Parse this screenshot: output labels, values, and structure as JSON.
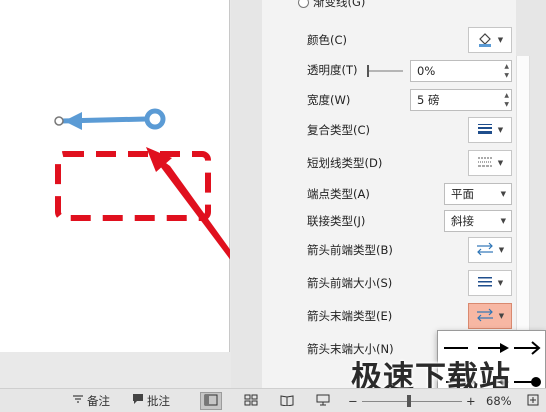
{
  "pane": {
    "gradient_line_label": "渐变线(G)",
    "color_label": "颜色(C)",
    "transparency_label": "透明度(T)",
    "transparency_value": "0%",
    "width_label": "宽度(W)",
    "width_value": "5 磅",
    "compound_type_label": "复合类型(C)",
    "dash_type_label": "短划线类型(D)",
    "cap_type_label": "端点类型(A)",
    "cap_type_value": "平面",
    "join_type_label": "联接类型(J)",
    "join_type_value": "斜接",
    "begin_arrow_type_label": "箭头前端类型(B)",
    "begin_arrow_size_label": "箭头前端大小(S)",
    "end_arrow_type_label": "箭头末端类型(E)",
    "end_arrow_size_label": "箭头末端大小(N)"
  },
  "statusbar": {
    "notes_label": "备注",
    "comments_label": "批注",
    "zoom_minus": "−",
    "zoom_plus": "+",
    "zoom_value": "68%"
  },
  "watermark": "极速下载站",
  "colors": {
    "accent_blue": "#5b9bd5",
    "annotation_red": "#e0101e",
    "active_button": "#f7b7a3"
  }
}
